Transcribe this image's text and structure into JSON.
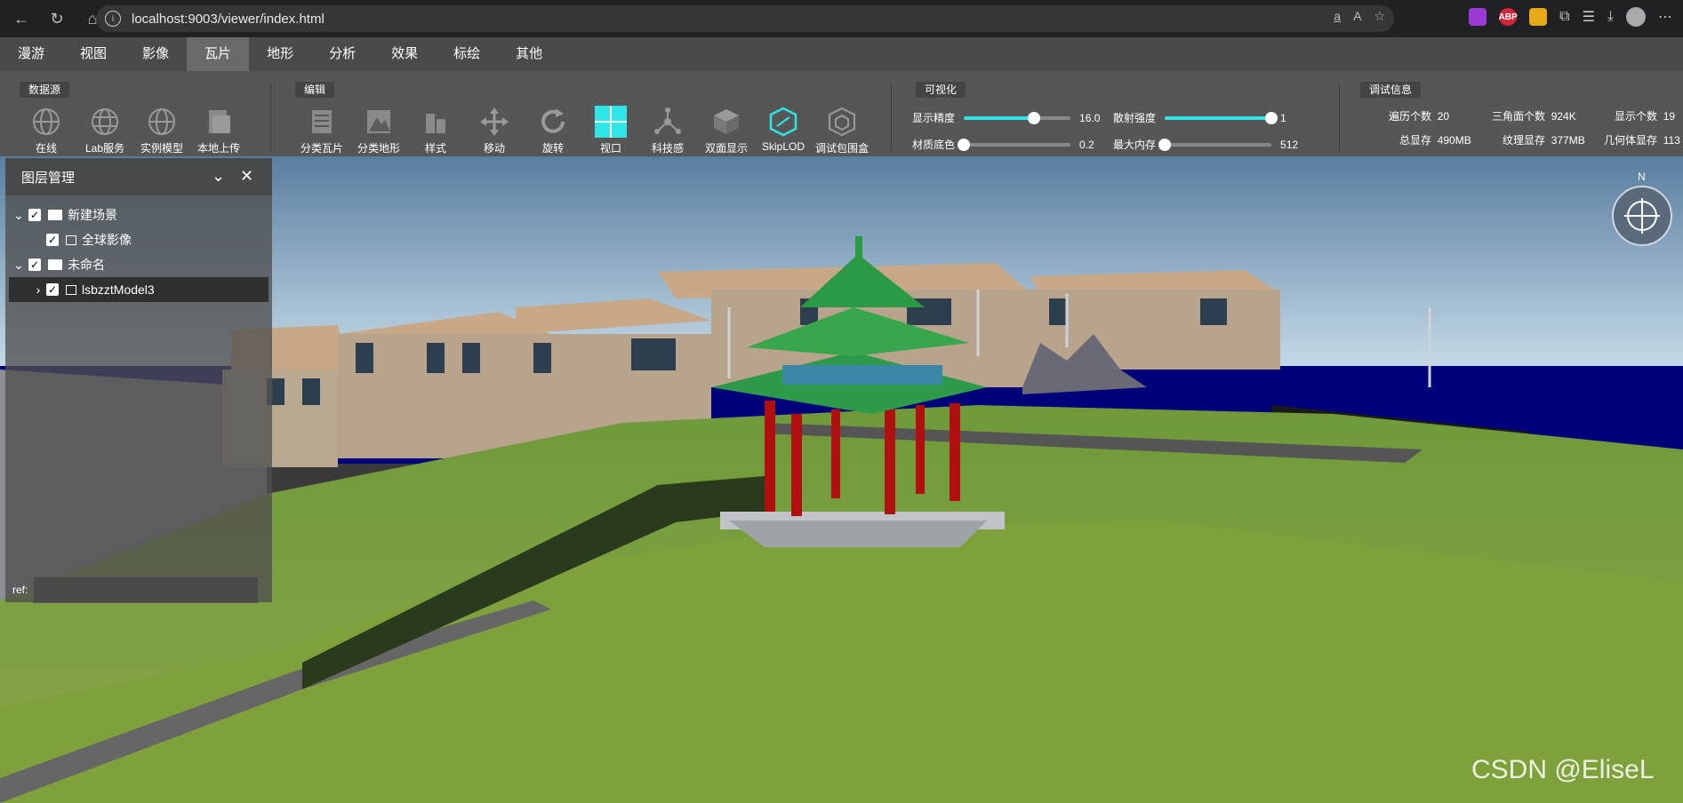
{
  "browser": {
    "url": "localhost:9003/viewer/index.html",
    "extensions": [
      {
        "name": "extension-a",
        "label": "",
        "color": "#9b3bd4"
      },
      {
        "name": "adblock",
        "label": "ABP",
        "color": "#d4243a"
      },
      {
        "name": "extension-b",
        "label": "",
        "color": "#e6a817"
      }
    ]
  },
  "menu": [
    "漫游",
    "视图",
    "影像",
    "瓦片",
    "地形",
    "分析",
    "效果",
    "标绘",
    "其他"
  ],
  "toolbar": {
    "groups": {
      "datasource": "数据源",
      "edit": "编辑",
      "visual": "可视化",
      "debug": "调试信息"
    },
    "datasource_tools": [
      "在线",
      "Lab服务",
      "实例模型",
      "本地上传"
    ],
    "edit_tools": [
      "分类瓦片",
      "分类地形",
      "样式",
      "移动",
      "旋转",
      "视口",
      "科技感",
      "双面显示",
      "SkipLOD",
      "调试包围盒"
    ],
    "visual": {
      "display_precision": {
        "label": "显示精度",
        "value": "16.0",
        "fraction": 0.66
      },
      "scatter_strength": {
        "label": "散射强度",
        "value": "1",
        "fraction": 1.0
      },
      "material_base": {
        "label": "材质底色",
        "value": "0.2",
        "fraction": 0.0
      },
      "max_memory": {
        "label": "最大内存",
        "value": "512",
        "fraction": 0.0
      }
    },
    "debug": {
      "traverse_count_label": "遍历个数",
      "traverse_count": "20",
      "triangle_count_label": "三角面个数",
      "triangle_count": "924K",
      "display_count_label": "显示个数",
      "display_count": "19",
      "total_memory_label": "总显存",
      "total_memory": "490MB",
      "texture_memory_label": "纹理显存",
      "texture_memory": "377MB",
      "geometry_memory_label": "几何体显存",
      "geometry_memory": "113"
    }
  },
  "layer_panel": {
    "title": "图层管理",
    "items": [
      {
        "label": "新建场景",
        "type": "folder",
        "checked": true,
        "expanded": true
      },
      {
        "label": "全球影像",
        "type": "image",
        "checked": true
      },
      {
        "label": "未命名",
        "type": "folder",
        "checked": true,
        "expanded": true
      },
      {
        "label": "lsbzztModel3",
        "type": "model",
        "checked": true,
        "selected": true
      }
    ],
    "ref_label": "ref:",
    "ref_value": ""
  },
  "compass_label": "N",
  "watermark": "CSDN @EliseL"
}
